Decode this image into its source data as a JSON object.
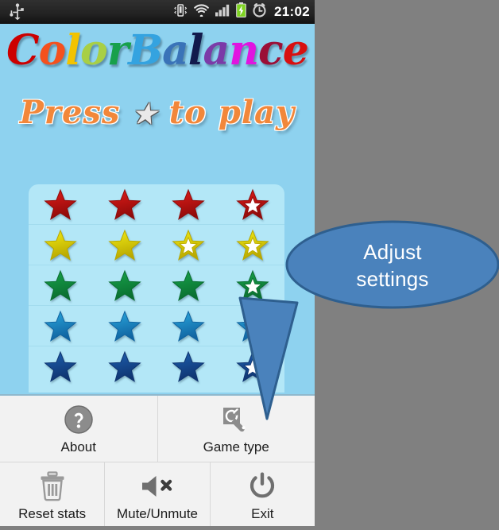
{
  "statusbar": {
    "time": "21:02",
    "icons": [
      "usb-icon",
      "vibrate-icon",
      "wifi-icon",
      "signal-icon",
      "battery-charging-icon",
      "alarm-icon"
    ]
  },
  "app": {
    "title_letters": [
      {
        "ch": "C",
        "color": "#CC0000"
      },
      {
        "ch": "o",
        "color": "#F4511E"
      },
      {
        "ch": "l",
        "color": "#F2C300"
      },
      {
        "ch": "o",
        "color": "#A8CF45"
      },
      {
        "ch": "r",
        "color": "#17A04A"
      },
      {
        "ch": "B",
        "color": "#34A3E0"
      },
      {
        "ch": "a",
        "color": "#3A73B8"
      },
      {
        "ch": "l",
        "color": "#121A4C"
      },
      {
        "ch": "a",
        "color": "#7B3BA8"
      },
      {
        "ch": "n",
        "color": "#E015E0"
      },
      {
        "ch": "c",
        "color": "#9B0F36"
      },
      {
        "ch": "e",
        "color": "#D81010"
      }
    ],
    "title_text": "ColorBalance",
    "subtitle_before": "Press ",
    "subtitle_star": "★",
    "subtitle_after": " to play",
    "subtitle_full": "Press ★ to play"
  },
  "stars": {
    "rows": [
      {
        "color": "#E01B18",
        "dark": "#8f0b0a",
        "name": "red-star-row",
        "cells": [
          "filled",
          "filled",
          "filled",
          "hollow"
        ]
      },
      {
        "color": "#F2EB14",
        "dark": "#b8a800",
        "name": "yellow-star-row",
        "cells": [
          "filled",
          "filled",
          "hollow",
          "hollow"
        ]
      },
      {
        "color": "#17A34A",
        "dark": "#0a6e30",
        "name": "green-star-row",
        "cells": [
          "filled",
          "filled",
          "filled",
          "hollow"
        ]
      },
      {
        "color": "#29A8DE",
        "dark": "#1063a0",
        "name": "cyan-star-row",
        "cells": [
          "filled",
          "filled",
          "filled",
          "hollow"
        ]
      },
      {
        "color": "#1D5FAF",
        "dark": "#0f3470",
        "name": "blue-star-row",
        "cells": [
          "filled",
          "filled",
          "filled",
          "hollow"
        ]
      }
    ]
  },
  "menu": {
    "row1": [
      {
        "label": "About",
        "icon": "help-icon"
      },
      {
        "label": "Game type",
        "icon": "wrench-settings-icon"
      }
    ],
    "row2": [
      {
        "label": "Reset stats",
        "icon": "trash-icon"
      },
      {
        "label": "Mute/Unmute",
        "icon": "mute-speaker-icon"
      },
      {
        "label": "Exit",
        "icon": "power-icon"
      }
    ]
  },
  "callout": {
    "line1": "Adjust",
    "line2": "settings",
    "text": "Adjust settings",
    "fill": "#4A82BC",
    "stroke": "#2E5F8F",
    "text_color": "#FFFFFF"
  },
  "colors": {
    "background": "#808080",
    "screen_bg": "#8ED2EF",
    "panel_bg": "#B3E7F7",
    "menu_bg": "#F2F2F2",
    "statusbar_bg": "#222222"
  }
}
